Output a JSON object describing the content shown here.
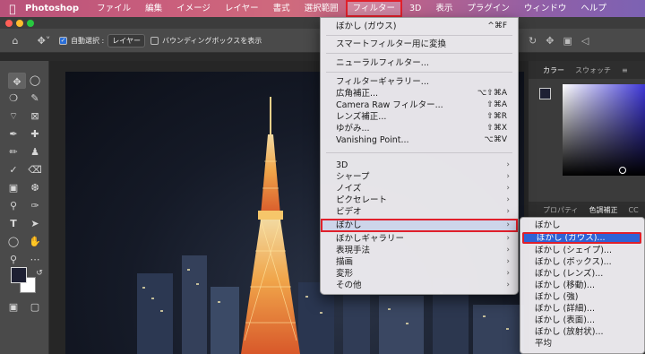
{
  "menubar": {
    "apple_icon": "apple-logo",
    "app_name": "Photoshop",
    "items": [
      "ファイル",
      "編集",
      "イメージ",
      "レイヤー",
      "書式",
      "選択範囲",
      "フィルター",
      "3D",
      "表示",
      "プラグイン",
      "ウィンドウ",
      "ヘルプ"
    ],
    "active_item": "フィルター"
  },
  "options": {
    "auto_select_label": "自動選択 :",
    "auto_select_value": "レイヤー",
    "bounding_box_label": "バウンディングボックスを表示"
  },
  "panels": {
    "color_tab": "カラー",
    "swatches_tab": "スウォッチ",
    "properties_tab": "プロパティ",
    "adjustments_tab": "色調補正",
    "cc_tab": "CC",
    "fg_color": "#1e2033",
    "bg_color": "#ffffff"
  },
  "filter_menu": {
    "last_filter": {
      "label": "ぼかし (ガウス)",
      "shortcut": "^⌘F"
    },
    "smart_filter": "スマートフィルター用に変換",
    "neural_filter": "ニューラルフィルター...",
    "group2": [
      {
        "label": "フィルターギャラリー...",
        "shortcut": ""
      },
      {
        "label": "広角補正...",
        "shortcut": "⌥⇧⌘A"
      },
      {
        "label": "Camera Raw フィルター...",
        "shortcut": "⇧⌘A"
      },
      {
        "label": "レンズ補正...",
        "shortcut": "⇧⌘R"
      },
      {
        "label": "ゆがみ...",
        "shortcut": "⇧⌘X"
      },
      {
        "label": "Vanishing Point...",
        "shortcut": "⌥⌘V"
      }
    ],
    "submenus": [
      "3D",
      "シャープ",
      "ノイズ",
      "ピクセレート",
      "ビデオ",
      "ぼかし",
      "ぼかしギャラリー",
      "表現手法",
      "描画",
      "変形",
      "その他"
    ],
    "highlighted": "ぼかし"
  },
  "blur_submenu": {
    "items": [
      "ぼかし",
      "ぼかし (ガウス)...",
      "ぼかし (シェイプ)...",
      "ぼかし (ボックス)...",
      "ぼかし (レンズ)...",
      "ぼかし (移動)...",
      "ぼかし (強)",
      "ぼかし (詳細)...",
      "ぼかし (表面)...",
      "ぼかし (放射状)...",
      "平均"
    ],
    "highlighted": "ぼかし (ガウス)..."
  }
}
